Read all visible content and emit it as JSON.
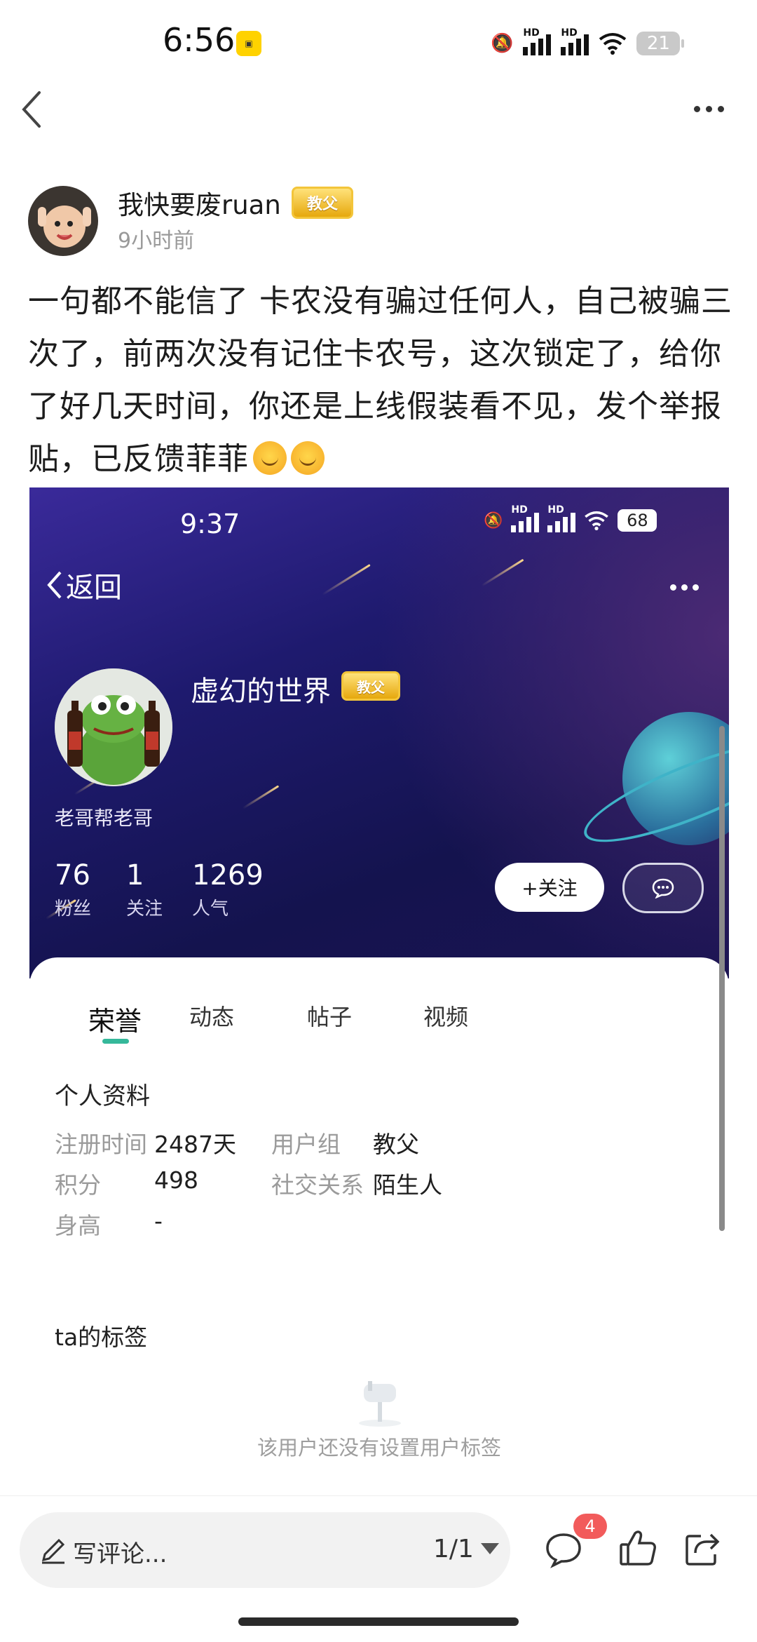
{
  "status_bar": {
    "time": "6:56",
    "hd1": "HD",
    "hd2": "HD",
    "battery": "21"
  },
  "author": {
    "name": "我快要废ruan",
    "badge": "教父",
    "time": "9小时前"
  },
  "post": {
    "text": "一句都不能信了 卡农没有骗过任何人，自己被骗三次了，前两次没有记住卡农号，这次锁定了，给你了好几天时间，你还是上线假装看不见，发个举报贴，已反馈菲菲"
  },
  "embed": {
    "time": "9:37",
    "hd1": "HD",
    "hd2": "HD",
    "battery": "68",
    "back_label": "返回",
    "username": "虚幻的世界",
    "badge": "教父",
    "signature": "老哥帮老哥",
    "stats": [
      {
        "num": "76",
        "label": "粉丝"
      },
      {
        "num": "1",
        "label": "关注"
      },
      {
        "num": "1269",
        "label": "人气"
      }
    ],
    "follow_label": "+关注",
    "tabs": [
      "荣誉",
      "动态",
      "帖子",
      "视频"
    ],
    "profile_title": "个人资料",
    "fields": [
      {
        "label": "注册时间",
        "value": "2487天"
      },
      {
        "label": "用户组",
        "value": "教父"
      },
      {
        "label": "积分",
        "value": "498"
      },
      {
        "label": "社交关系",
        "value": "陌生人"
      },
      {
        "label": "身高",
        "value": "-"
      }
    ],
    "tags_title": "ta的标签",
    "empty_tags": "该用户还没有设置用户标签"
  },
  "bottom_bar": {
    "comment_placeholder": "写评论...",
    "page": "1/1",
    "comment_count": "4"
  },
  "colors": {
    "accent_green": "#35b89a",
    "badge_gold": "#e6a80d",
    "notification_red": "#f25b5b",
    "header_navy": "#1e1a6e"
  }
}
